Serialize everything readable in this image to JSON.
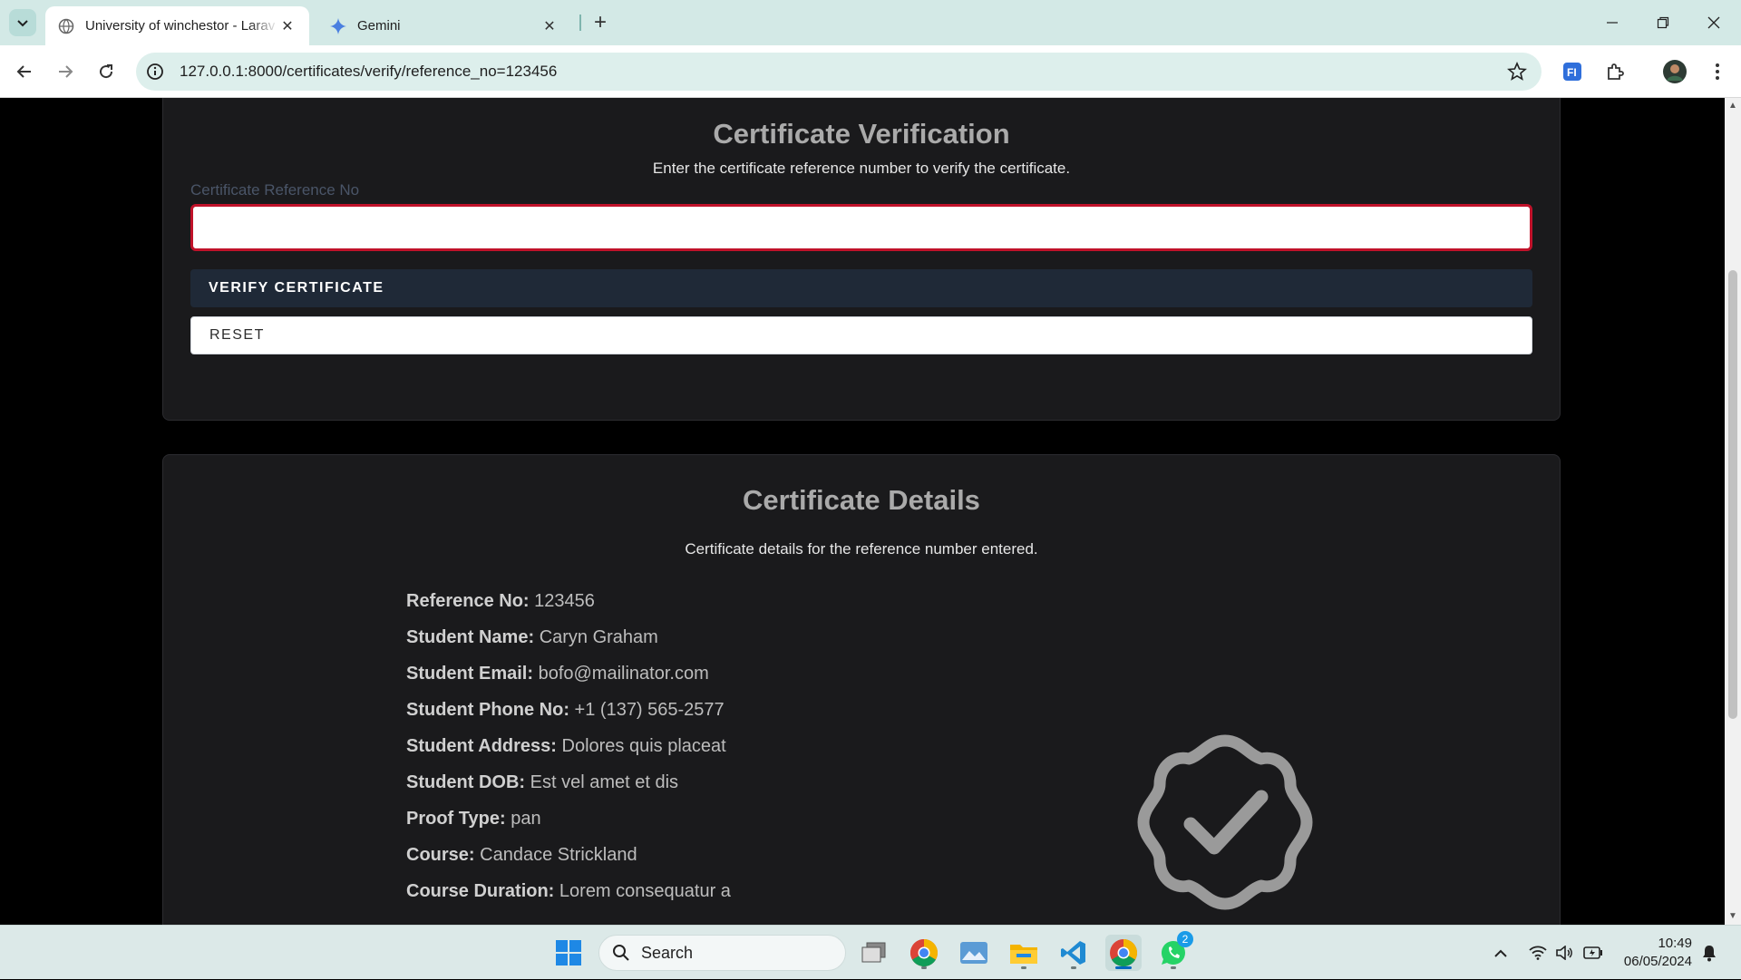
{
  "browser": {
    "tabs": [
      {
        "title": "University of winchestor - Larav",
        "active": true
      },
      {
        "title": "Gemini",
        "active": false
      }
    ],
    "url": "127.0.0.1:8000/certificates/verify/reference_no=123456"
  },
  "verification": {
    "title": "Certificate Verification",
    "subtitle": "Enter the certificate reference number to verify the certificate.",
    "field_label": "Certificate Reference No",
    "field_value": "",
    "verify_label": "VERIFY CERTIFICATE",
    "reset_label": "RESET"
  },
  "details": {
    "title": "Certificate Details",
    "subtitle": "Certificate details for the reference number entered.",
    "rows": [
      {
        "label": "Reference No:",
        "value": "123456"
      },
      {
        "label": "Student Name:",
        "value": "Caryn Graham"
      },
      {
        "label": "Student Email:",
        "value": "bofo@mailinator.com"
      },
      {
        "label": "Student Phone No:",
        "value": "+1 (137) 565-2577"
      },
      {
        "label": "Student Address:",
        "value": "Dolores quis placeat"
      },
      {
        "label": "Student DOB:",
        "value": "Est vel amet et dis"
      },
      {
        "label": "Proof Type:",
        "value": "pan"
      },
      {
        "label": "Course:",
        "value": "Candace Strickland"
      },
      {
        "label": "Course Duration:",
        "value": "Lorem consequatur a"
      }
    ]
  },
  "taskbar": {
    "search_label": "Search",
    "whatsapp_badge": "2",
    "time": "10:49",
    "date": "06/05/2024"
  }
}
